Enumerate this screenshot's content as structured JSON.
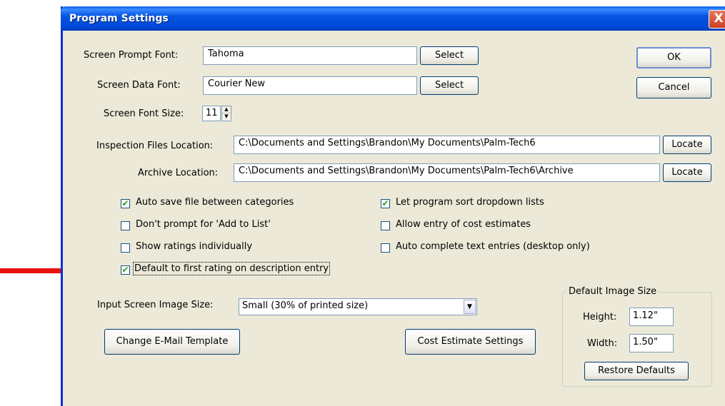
{
  "window": {
    "title": "Program Settings",
    "close_glyph": "X"
  },
  "fonts": {
    "prompt_label": "Screen Prompt Font:",
    "prompt_value": "Tahoma",
    "data_label": "Screen Data Font:",
    "data_value": "Courier New",
    "select_label": "Select",
    "size_label": "Screen Font Size:",
    "size_value": "11"
  },
  "buttons": {
    "ok": "OK",
    "cancel": "Cancel"
  },
  "locations": {
    "inspection_label": "Inspection Files Location:",
    "inspection_value": "C:\\Documents and Settings\\Brandon\\My Documents\\Palm-Tech6",
    "archive_label": "Archive Location:",
    "archive_value": "C:\\Documents and Settings\\Brandon\\My Documents\\Palm-Tech6\\Archive",
    "locate_label": "Locate"
  },
  "options": {
    "left": [
      {
        "label": "Auto save file between categories",
        "checked": true
      },
      {
        "label": "Don't prompt for 'Add to List'",
        "checked": false
      },
      {
        "label": "Show ratings individually",
        "checked": false
      },
      {
        "label": "Default to first rating on description entry",
        "checked": true
      }
    ],
    "right": [
      {
        "label": "Let program sort dropdown lists",
        "checked": true
      },
      {
        "label": "Allow entry of cost estimates",
        "checked": false
      },
      {
        "label": "Auto complete text entries (desktop only)",
        "checked": false
      }
    ]
  },
  "image": {
    "input_label": "Input Screen Image Size:",
    "input_value": "Small (30% of printed size)",
    "group_title": "Default Image Size",
    "height_label": "Height:",
    "height_value": "1.12\"",
    "width_label": "Width:",
    "width_value": "1.50\"",
    "restore_label": "Restore Defaults"
  },
  "actions": {
    "email_template": "Change E-Mail Template",
    "cost_settings": "Cost Estimate Settings"
  },
  "annotation": {
    "arrow_color": "#e8120c"
  }
}
